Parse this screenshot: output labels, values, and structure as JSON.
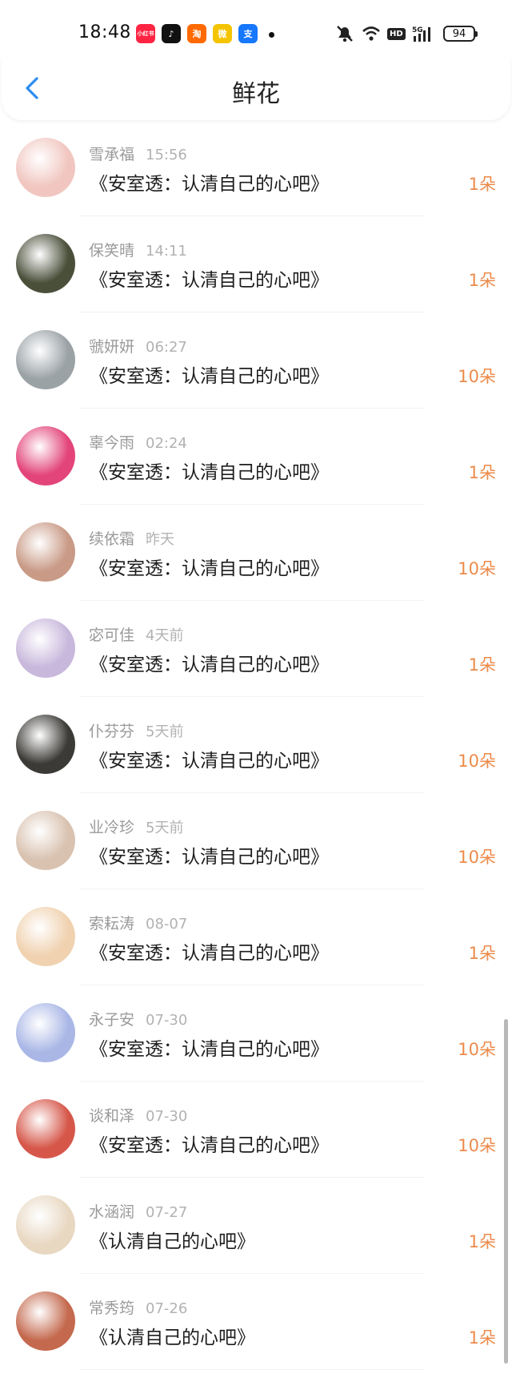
{
  "status_bar": {
    "time": "18:48",
    "battery": "94",
    "app_icons": [
      {
        "name": "xiaohongshu-icon",
        "glyph": "小红书",
        "color": "#ff2442"
      },
      {
        "name": "douyin-icon",
        "glyph": "♪",
        "color": "#111111"
      },
      {
        "name": "taobao-icon",
        "glyph": "淘",
        "color": "#ff6a00"
      },
      {
        "name": "weibo-icon",
        "glyph": "微",
        "color": "#f5c400"
      },
      {
        "name": "alipay-icon",
        "glyph": "支",
        "color": "#1677ff"
      }
    ]
  },
  "header": {
    "title": "鲜花"
  },
  "flowers": [
    {
      "user": "雪承福",
      "when": "15:56",
      "message": "《安室透：认清自己的心吧》",
      "count": "1朵",
      "avatar_color": "#f1c6c0"
    },
    {
      "user": "保笑晴",
      "when": "14:11",
      "message": "《安室透：认清自己的心吧》",
      "count": "1朵",
      "avatar_color": "#4a4f3a"
    },
    {
      "user": "虢妍妍",
      "when": "06:27",
      "message": "《安室透：认清自己的心吧》",
      "count": "10朵",
      "avatar_color": "#9aa2a6"
    },
    {
      "user": "辜今雨",
      "when": "02:24",
      "message": "《安室透：认清自己的心吧》",
      "count": "1朵",
      "avatar_color": "#e3457a"
    },
    {
      "user": "续依霜",
      "when": "昨天",
      "message": "《安室透：认清自己的心吧》",
      "count": "10朵",
      "avatar_color": "#c99a86"
    },
    {
      "user": "宓可佳",
      "when": "4天前",
      "message": "《安室透：认清自己的心吧》",
      "count": "1朵",
      "avatar_color": "#c8b8dc"
    },
    {
      "user": "仆芬芬",
      "when": "5天前",
      "message": "《安室透：认清自己的心吧》",
      "count": "10朵",
      "avatar_color": "#3b3a36"
    },
    {
      "user": "业冷珍",
      "when": "5天前",
      "message": "《安室透：认清自己的心吧》",
      "count": "10朵",
      "avatar_color": "#d9c2b0"
    },
    {
      "user": "索耘涛",
      "when": "08-07",
      "message": "《安室透：认清自己的心吧》",
      "count": "1朵",
      "avatar_color": "#f0d2b0"
    },
    {
      "user": "永子安",
      "when": "07-30",
      "message": "《安室透：认清自己的心吧》",
      "count": "10朵",
      "avatar_color": "#aab7e6"
    },
    {
      "user": "谈和泽",
      "when": "07-30",
      "message": "《安室透：认清自己的心吧》",
      "count": "10朵",
      "avatar_color": "#d6574a"
    },
    {
      "user": "水涵润",
      "when": "07-27",
      "message": "《认清自己的心吧》",
      "count": "1朵",
      "avatar_color": "#e8d8c2"
    },
    {
      "user": "常秀筠",
      "when": "07-26",
      "message": "《认清自己的心吧》",
      "count": "1朵",
      "avatar_color": "#c4694e"
    }
  ]
}
